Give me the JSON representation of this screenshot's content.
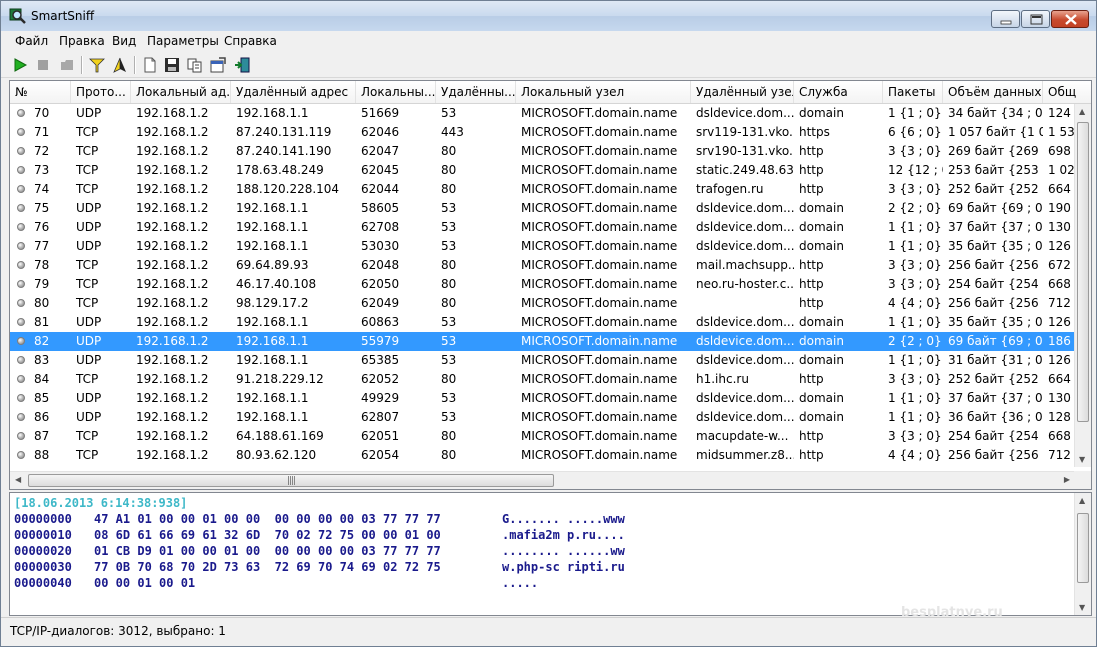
{
  "window": {
    "title": "SmartSniff"
  },
  "menu": [
    "Файл",
    "Правка",
    "Вид",
    "Параметры",
    "Справка"
  ],
  "table": {
    "columns": [
      "№",
      "Прото...",
      "Локальный ад...",
      "Удалённый адрес",
      "Локальны...",
      "Удалённы...",
      "Локальный узел",
      "Удалённый узел",
      "Служба",
      "Пакеты",
      "Объём данных",
      "Общ"
    ],
    "rows": [
      [
        "70",
        "UDP",
        "192.168.1.2",
        "192.168.1.1",
        "51669",
        "53",
        "MICROSOFT.domain.name",
        "dsldevice.dom...",
        "domain",
        "1 {1 ; 0}",
        "34 байт {34 ; 0}",
        "124"
      ],
      [
        "71",
        "TCP",
        "192.168.1.2",
        "87.240.131.119",
        "62046",
        "443",
        "MICROSOFT.domain.name",
        "srv119-131.vko...",
        "https",
        "6 {6 ; 0}",
        "1 057 байт {1 0...",
        "1 53"
      ],
      [
        "72",
        "TCP",
        "192.168.1.2",
        "87.240.141.190",
        "62047",
        "80",
        "MICROSOFT.domain.name",
        "srv190-131.vko...",
        "http",
        "3 {3 ; 0}",
        "269 байт {269 ;...",
        "698"
      ],
      [
        "73",
        "TCP",
        "192.168.1.2",
        "178.63.48.249",
        "62045",
        "80",
        "MICROSOFT.domain.name",
        "static.249.48.63....",
        "http",
        "12 {12 ; 0}",
        "253 байт {253 ;...",
        "1 02"
      ],
      [
        "74",
        "TCP",
        "192.168.1.2",
        "188.120.228.104",
        "62044",
        "80",
        "MICROSOFT.domain.name",
        "trafogen.ru",
        "http",
        "3 {3 ; 0}",
        "252 байт {252 ;...",
        "664"
      ],
      [
        "75",
        "UDP",
        "192.168.1.2",
        "192.168.1.1",
        "58605",
        "53",
        "MICROSOFT.domain.name",
        "dsldevice.dom...",
        "domain",
        "2 {2 ; 0}",
        "69 байт {69 ; 0}",
        "190"
      ],
      [
        "76",
        "UDP",
        "192.168.1.2",
        "192.168.1.1",
        "62708",
        "53",
        "MICROSOFT.domain.name",
        "dsldevice.dom...",
        "domain",
        "1 {1 ; 0}",
        "37 байт {37 ; 0}",
        "130"
      ],
      [
        "77",
        "UDP",
        "192.168.1.2",
        "192.168.1.1",
        "53030",
        "53",
        "MICROSOFT.domain.name",
        "dsldevice.dom...",
        "domain",
        "1 {1 ; 0}",
        "35 байт {35 ; 0}",
        "126"
      ],
      [
        "78",
        "TCP",
        "192.168.1.2",
        "69.64.89.93",
        "62048",
        "80",
        "MICROSOFT.domain.name",
        "mail.machsupp...",
        "http",
        "3 {3 ; 0}",
        "256 байт {256 ;...",
        "672"
      ],
      [
        "79",
        "TCP",
        "192.168.1.2",
        "46.17.40.108",
        "62050",
        "80",
        "MICROSOFT.domain.name",
        "neo.ru-hoster.c...",
        "http",
        "3 {3 ; 0}",
        "254 байт {254 ;...",
        "668"
      ],
      [
        "80",
        "TCP",
        "192.168.1.2",
        "98.129.17.2",
        "62049",
        "80",
        "MICROSOFT.domain.name",
        "",
        "http",
        "4 {4 ; 0}",
        "256 байт {256 ;...",
        "712"
      ],
      [
        "81",
        "UDP",
        "192.168.1.2",
        "192.168.1.1",
        "60863",
        "53",
        "MICROSOFT.domain.name",
        "dsldevice.dom...",
        "domain",
        "1 {1 ; 0}",
        "35 байт {35 ; 0}",
        "126"
      ],
      [
        "82",
        "UDP",
        "192.168.1.2",
        "192.168.1.1",
        "55979",
        "53",
        "MICROSOFT.domain.name",
        "dsldevice.dom...",
        "domain",
        "2 {2 ; 0}",
        "69 байт {69 ; 0}",
        "186"
      ],
      [
        "83",
        "UDP",
        "192.168.1.2",
        "192.168.1.1",
        "65385",
        "53",
        "MICROSOFT.domain.name",
        "dsldevice.dom...",
        "domain",
        "1 {1 ; 0}",
        "31 байт {31 ; 0}",
        "126"
      ],
      [
        "84",
        "TCP",
        "192.168.1.2",
        "91.218.229.12",
        "62052",
        "80",
        "MICROSOFT.domain.name",
        "h1.ihc.ru",
        "http",
        "3 {3 ; 0}",
        "252 байт {252 ;...",
        "664"
      ],
      [
        "85",
        "UDP",
        "192.168.1.2",
        "192.168.1.1",
        "49929",
        "53",
        "MICROSOFT.domain.name",
        "dsldevice.dom...",
        "domain",
        "1 {1 ; 0}",
        "37 байт {37 ; 0}",
        "130"
      ],
      [
        "86",
        "UDP",
        "192.168.1.2",
        "192.168.1.1",
        "62807",
        "53",
        "MICROSOFT.domain.name",
        "dsldevice.dom...",
        "domain",
        "1 {1 ; 0}",
        "36 байт {36 ; 0}",
        "128"
      ],
      [
        "87",
        "TCP",
        "192.168.1.2",
        "64.188.61.169",
        "62051",
        "80",
        "MICROSOFT.domain.name",
        "macupdate-w...",
        "http",
        "3 {3 ; 0}",
        "254 байт {254 ;...",
        "668"
      ],
      [
        "88",
        "TCP",
        "192.168.1.2",
        "80.93.62.120",
        "62054",
        "80",
        "MICROSOFT.domain.name",
        "midsummer.z8....",
        "http",
        "4 {4 ; 0}",
        "256 байт {256 ;...",
        "712"
      ]
    ],
    "selected_index": 12
  },
  "hex": {
    "timestamp": "[18.06.2013 6:14:38:938]",
    "lines": [
      {
        "offset": "00000000",
        "bytes": "47 A1 01 00 00 01 00 00  00 00 00 00 03 77 77 77",
        "ascii": "G....... .....www"
      },
      {
        "offset": "00000010",
        "bytes": "08 6D 61 66 69 61 32 6D  70 02 72 75 00 00 01 00",
        "ascii": ".mafia2m p.ru...."
      },
      {
        "offset": "00000020",
        "bytes": "01 CB D9 01 00 00 01 00  00 00 00 00 03 77 77 77",
        "ascii": "........ ......ww"
      },
      {
        "offset": "00000030",
        "bytes": "77 0B 70 68 70 2D 73 63  72 69 70 74 69 02 72 75",
        "ascii": "w.php-sc ripti.ru"
      },
      {
        "offset": "00000040",
        "bytes": "00 00 01 00 01",
        "ascii": "....."
      }
    ]
  },
  "status": {
    "text": "TCP/IP-диалогов: 3012, выбрано: 1"
  },
  "watermark": "besplatnye.ru",
  "colors": {
    "selection": "#3399ff",
    "hex_timestamp": "#3eb8c8",
    "hex_text": "#1a1a8c"
  }
}
